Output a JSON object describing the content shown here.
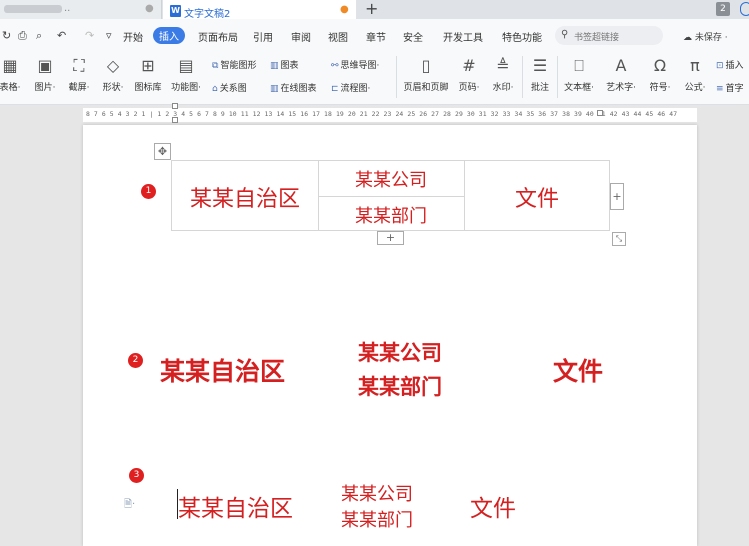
{
  "titlebar": {
    "blurred_tab_suffix": "..",
    "blurred_tab_dot": "●",
    "active_tab_icon": "W",
    "active_tab_label": "文字文稿2",
    "active_tab_unsaved_dot": "●",
    "new_tab": "+",
    "window_count": "2"
  },
  "menu": {
    "items": [
      "开始",
      "插入",
      "页面布局",
      "引用",
      "审阅",
      "视图",
      "章节",
      "安全",
      "开发工具",
      "特色功能"
    ],
    "active": "插入",
    "search_placeholder": "书签超链接",
    "unsaved_label": "未保存 ·"
  },
  "ribbon": {
    "table": "表格·",
    "picture": "图片·",
    "screenshot": "截屏·",
    "shape": "形状·",
    "icon_lib": "图标库",
    "func_chart": "功能图·",
    "smart_shape": "智能图形",
    "chart": "图表",
    "mind_map": "思维导图·",
    "relation": "关系图",
    "online_chart": "在线图表",
    "flowchart": "流程图·",
    "header_footer": "页眉和页脚",
    "page_num": "页码·",
    "watermark": "水印·",
    "comment": "批注",
    "textbox": "文本框·",
    "wordart": "艺术字·",
    "symbol": "符号·",
    "formula": "公式·",
    "insert_num": "插入",
    "dropcap": "首字"
  },
  "ruler": {
    "text": "8 7 6 5 4 3 2 1 | 1 2 3 4 5 6 7 8 9 10 11 12 13 14 15 16 17 18 19 20 21 22 23 24 25 26 27 28 29 30 31 32 33 34 35 36 37 38 39 40 41 42 43 44 45 46 47"
  },
  "document": {
    "marker1": "1",
    "marker2": "2",
    "marker3": "3",
    "table": {
      "left": "某某自治区",
      "mid_top": "某某公司",
      "mid_bottom": "某某部门",
      "right": "文件"
    },
    "section2": {
      "left": "某某自治区",
      "mid_top": "某某公司",
      "mid_bottom": "某某部门",
      "right": "文件"
    },
    "section3": {
      "left": "某某自治区",
      "mid_top": "某某公司",
      "mid_bottom": "某某部门",
      "right": "文件"
    },
    "add_column": "+",
    "add_row": "+"
  },
  "colors": {
    "accent": "#3b7be6",
    "doc_red": "#d42020",
    "marker_red": "#e02020"
  }
}
